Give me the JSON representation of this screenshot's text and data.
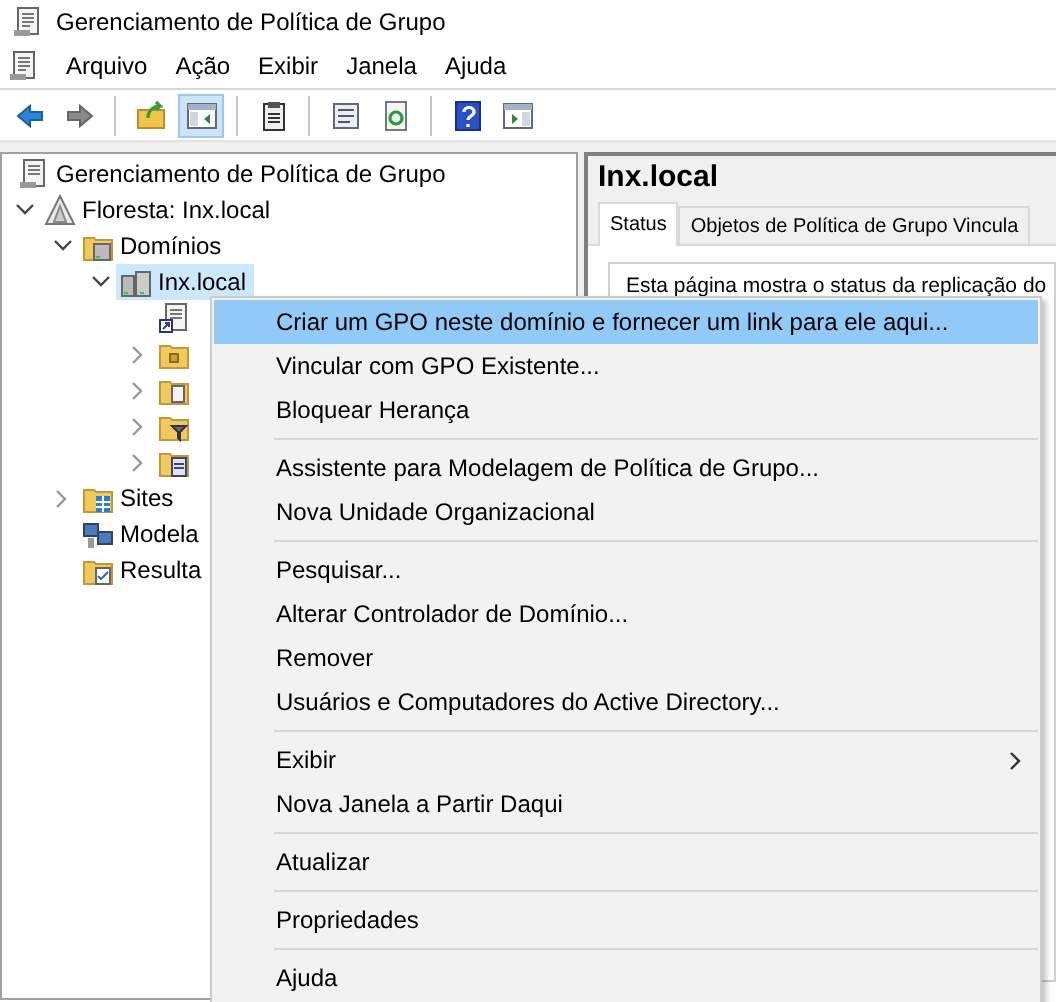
{
  "window": {
    "title": "Gerenciamento de Política de Grupo"
  },
  "menu_bar": [
    "Arquivo",
    "Ação",
    "Exibir",
    "Janela",
    "Ajuda"
  ],
  "toolbar": [
    {
      "kind": "back",
      "pressed": false
    },
    {
      "kind": "forward",
      "pressed": false
    },
    {
      "kind": "separator"
    },
    {
      "kind": "up",
      "pressed": false
    },
    {
      "kind": "pane",
      "pressed": true
    },
    {
      "kind": "separator"
    },
    {
      "kind": "clipboard",
      "pressed": false
    },
    {
      "kind": "separator"
    },
    {
      "kind": "properties",
      "pressed": false
    },
    {
      "kind": "refresh",
      "pressed": false
    },
    {
      "kind": "separator"
    },
    {
      "kind": "help",
      "pressed": false
    },
    {
      "kind": "action-pane",
      "pressed": false
    }
  ],
  "tree": {
    "label": "Gerenciamento de Política de Grupo",
    "kind": "root",
    "selected": false,
    "children": [
      {
        "label": "Floresta: Inx.local",
        "kind": "forest",
        "expanded": true,
        "selected": false,
        "children": [
          {
            "label": "Domínios",
            "kind": "domains",
            "expanded": true,
            "selected": false,
            "children": [
              {
                "label": "Inx.local",
                "kind": "domain",
                "expanded": true,
                "selected": true,
                "children": [
                  {
                    "kind": "gpo-link",
                    "selected": false
                  },
                  {
                    "kind": "ou-folder",
                    "expanded": false,
                    "selected": false
                  },
                  {
                    "kind": "gpo-folder",
                    "expanded": false,
                    "selected": false
                  },
                  {
                    "kind": "filter-folder",
                    "expanded": false,
                    "selected": false
                  },
                  {
                    "kind": "starter-folder",
                    "expanded": false,
                    "selected": false
                  }
                ]
              }
            ]
          },
          {
            "label": "Sites",
            "kind": "sites",
            "expanded": false,
            "selected": false
          },
          {
            "label": "Modela",
            "kind": "modeling",
            "selected": false
          },
          {
            "label": "Resulta",
            "kind": "results",
            "selected": false
          }
        ]
      }
    ]
  },
  "details": {
    "title": "Inx.local",
    "tabs": [
      {
        "label": "Status",
        "selected": true
      },
      {
        "label": "Objetos de Política de Grupo Vincula",
        "selected": false
      }
    ],
    "text": "Esta página mostra o status da replicação do"
  },
  "context_menu": [
    {
      "kind": "item",
      "label": "Criar um GPO neste domínio e fornecer um link para ele aqui...",
      "selected": true
    },
    {
      "kind": "item",
      "label": "Vincular com GPO Existente...",
      "selected": false
    },
    {
      "kind": "item",
      "label": "Bloquear Herança",
      "selected": false
    },
    {
      "kind": "separator"
    },
    {
      "kind": "item",
      "label": "Assistente para Modelagem de Política de Grupo...",
      "selected": false
    },
    {
      "kind": "item",
      "label": "Nova Unidade Organizacional",
      "selected": false
    },
    {
      "kind": "separator"
    },
    {
      "kind": "item",
      "label": "Pesquisar...",
      "selected": false
    },
    {
      "kind": "item",
      "label": "Alterar Controlador de Domínio...",
      "selected": false
    },
    {
      "kind": "item",
      "label": "Remover",
      "selected": false
    },
    {
      "kind": "item",
      "label": "Usuários e Computadores do Active Directory...",
      "selected": false
    },
    {
      "kind": "separator"
    },
    {
      "kind": "item",
      "label": "Exibir",
      "selected": false,
      "submenu": true
    },
    {
      "kind": "item",
      "label": "Nova Janela a Partir Daqui",
      "selected": false
    },
    {
      "kind": "separator"
    },
    {
      "kind": "item",
      "label": "Atualizar",
      "selected": false
    },
    {
      "kind": "separator"
    },
    {
      "kind": "item",
      "label": "Propriedades",
      "selected": false
    },
    {
      "kind": "separator"
    },
    {
      "kind": "item",
      "label": "Ajuda",
      "selected": false
    }
  ]
}
